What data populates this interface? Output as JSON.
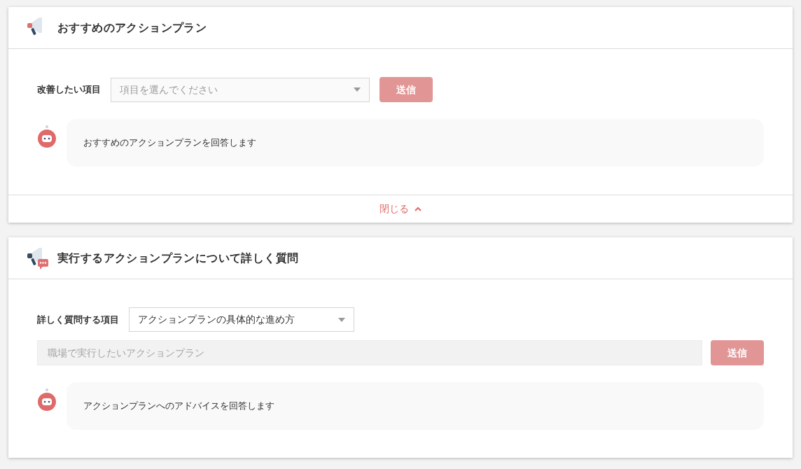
{
  "panels": [
    {
      "kind": "announcement",
      "title": "おすすめのアクションプラン",
      "select": {
        "label": "改善したい項目",
        "placeholder": "項目を選んでください"
      },
      "submit": {
        "label": "送信",
        "disabled": true
      },
      "answer": "おすすめのアクションプランを回答します",
      "collapse": {
        "label": "閉じる",
        "expanded": true
      }
    },
    {
      "kind": "question",
      "title": "実行するアクションプランについて詳しく質問",
      "select": {
        "label": "詳しく質問する項目",
        "value": "アクションプランの具体的な進め方"
      },
      "input": {
        "placeholder": "職場で実行したいアクションプラン",
        "disabled": true
      },
      "submit": {
        "label": "送信",
        "disabled": true
      },
      "answer": "アクションプランへのアドバイスを回答します"
    }
  ]
}
